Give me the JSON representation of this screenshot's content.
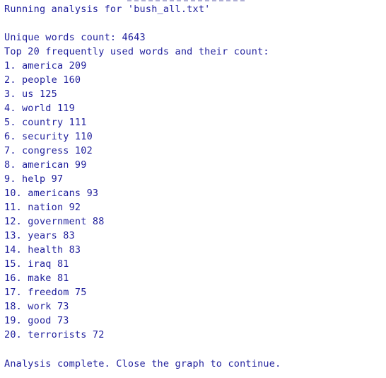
{
  "console": {
    "header": "Running analysis for 'bush_all.txt'",
    "unique_count": "Unique words count: 4643",
    "top_heading": "Top 20 frequently used words and their count:",
    "items": [
      "1. america 209",
      "2. people 160",
      "3. us 125",
      "4. world 119",
      "5. country 111",
      "6. security 110",
      "7. congress 102",
      "8. american 99",
      "9. help 97",
      "10. americans 93",
      "11. nation 92",
      "12. government 88",
      "13. years 83",
      "14. health 83",
      "15. iraq 81",
      "16. make 81",
      "17. freedom 75",
      "18. work 73",
      "19. good 73",
      "20. terrorists 72"
    ],
    "footer": "Analysis complete. Close the graph to continue."
  },
  "colors": {
    "text": "#1f1f9c",
    "background": "#ffffff"
  }
}
